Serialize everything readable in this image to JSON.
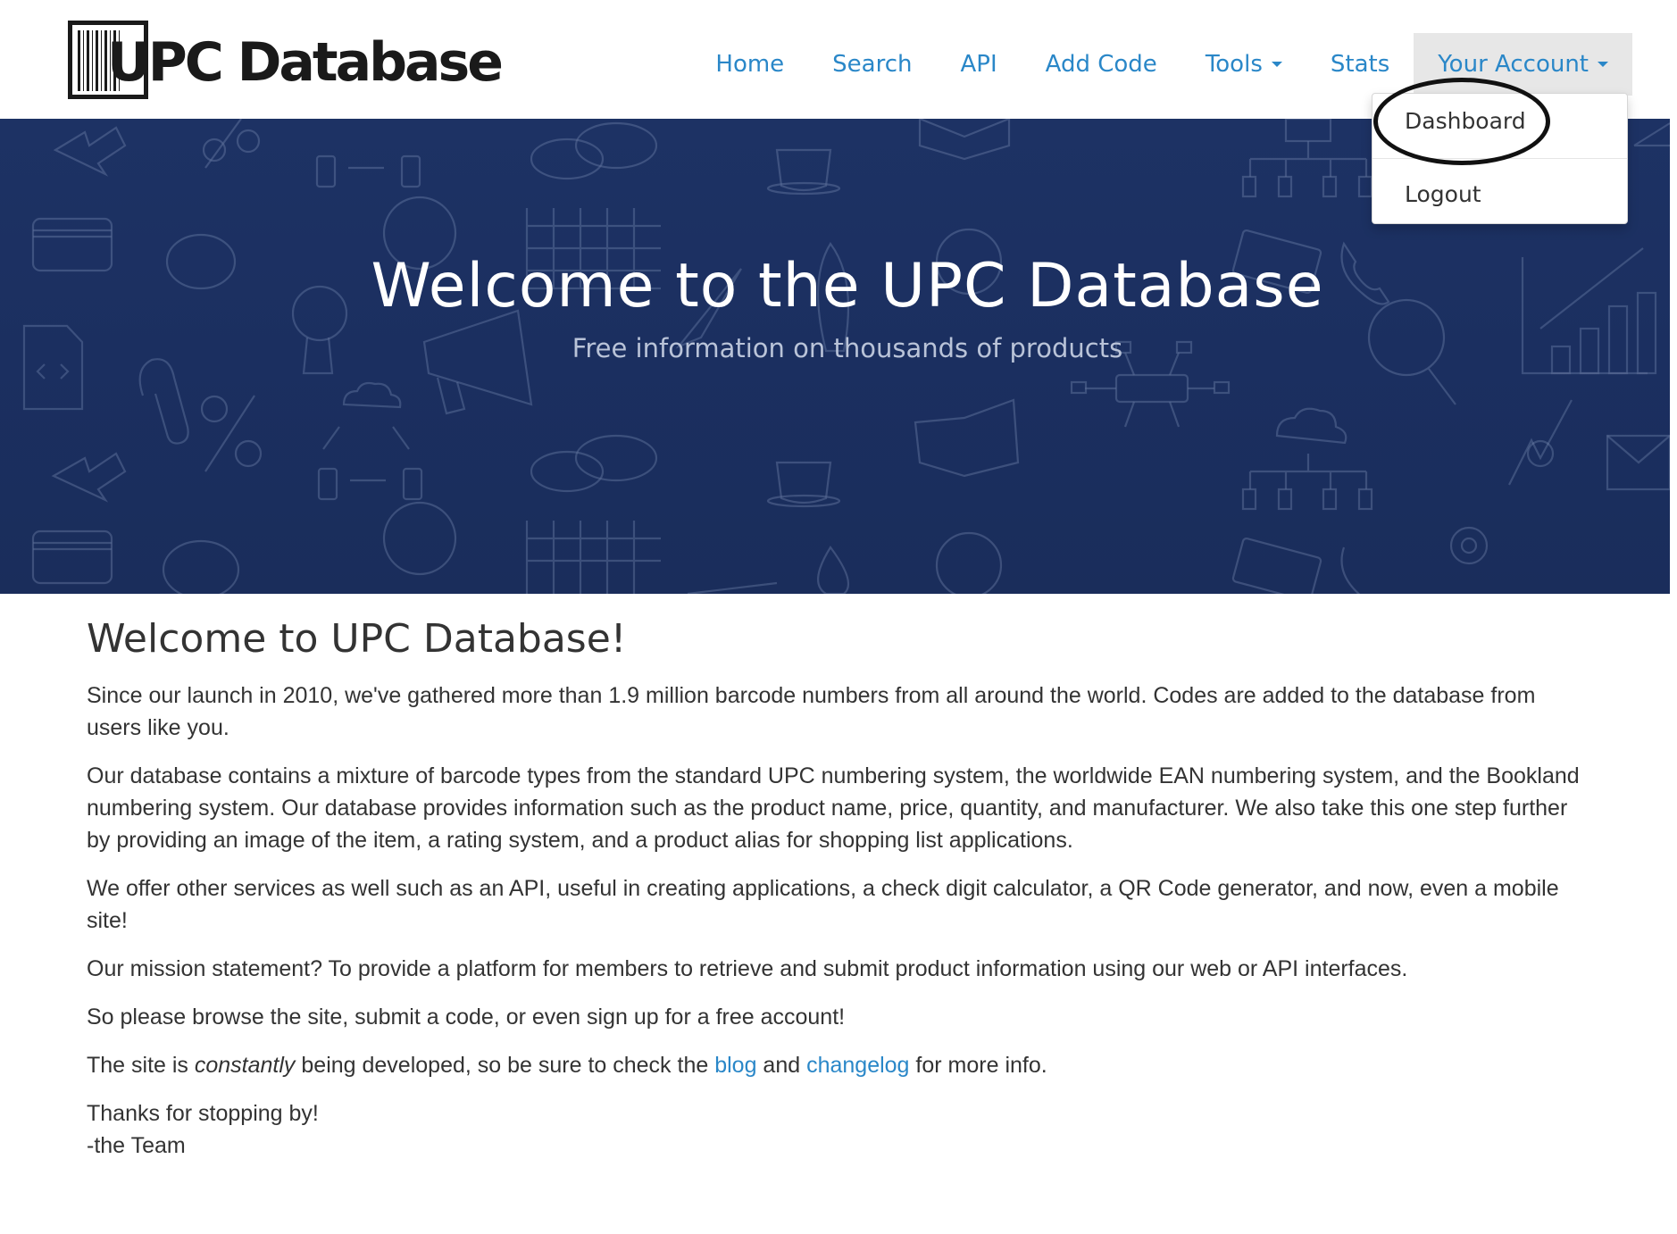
{
  "logo": {
    "text": "UPC Database"
  },
  "nav": {
    "items": [
      {
        "label": "Home"
      },
      {
        "label": "Search"
      },
      {
        "label": "API"
      },
      {
        "label": "Add Code"
      },
      {
        "label": "Tools"
      },
      {
        "label": "Stats"
      },
      {
        "label": "Your Account"
      }
    ]
  },
  "account_menu": {
    "items": [
      {
        "label": "Dashboard"
      },
      {
        "label": "Logout"
      }
    ]
  },
  "hero": {
    "title": "Welcome to the UPC Database",
    "subtitle": "Free information on thousands of products"
  },
  "content": {
    "heading": "Welcome to UPC Database!",
    "p1": "Since our launch in 2010, we've gathered more than 1.9 million barcode numbers from all around the world. Codes are added to the database from users like you.",
    "p2": "Our database contains a mixture of barcode types from the standard UPC numbering system, the worldwide EAN numbering system, and the Bookland numbering system. Our database provides information such as the product name, price, quantity, and manufacturer. We also take this one step further by providing an image of the item, a rating system, and a product alias for shopping list applications.",
    "p3": "We offer other services as well such as an API, useful in creating applications, a check digit calculator, a QR Code generator, and now, even a mobile site!",
    "p4": "Our mission statement? To provide a platform for members to retrieve and submit product information using our web or API interfaces.",
    "p5": "So please browse the site, submit a code, or even sign up for a free account!",
    "p6": {
      "before": "The site is ",
      "emphasis": "constantly",
      "middle": " being developed, so be sure to check the ",
      "blog_link": "blog",
      "and": " and ",
      "changelog_link": "changelog",
      "after": " for more info."
    },
    "closing_line1": "Thanks for stopping by!",
    "closing_line2": "-the Team"
  },
  "colors": {
    "link": "#2a87c8",
    "hero_bg": "#1b2f60",
    "text": "#333333",
    "active_nav_bg": "#e7e7e7"
  }
}
